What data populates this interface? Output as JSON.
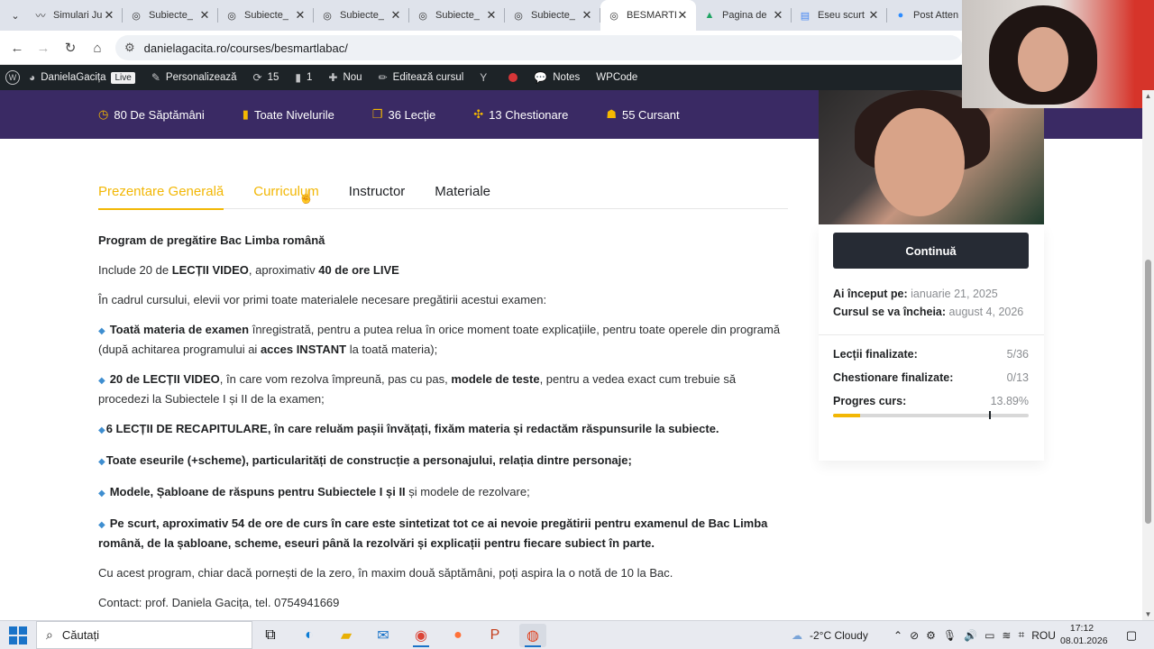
{
  "browser": {
    "tabs": [
      {
        "title": "Simulari Ju",
        "icon": "wave-icon"
      },
      {
        "title": "Subiecte_",
        "icon": "globe-icon"
      },
      {
        "title": "Subiecte_",
        "icon": "globe-icon"
      },
      {
        "title": "Subiecte_",
        "icon": "globe-icon"
      },
      {
        "title": "Subiecte_",
        "icon": "globe-icon"
      },
      {
        "title": "Subiecte_",
        "icon": "globe-icon"
      },
      {
        "title": "BESMARTL",
        "icon": "globe-icon",
        "active": true
      },
      {
        "title": "Pagina de",
        "icon": "drive-icon"
      },
      {
        "title": "Eseu scurt",
        "icon": "docs-icon"
      },
      {
        "title": "Post Atten",
        "icon": "zoom-icon"
      }
    ],
    "url": "danielagacita.ro/courses/besmartlabac/"
  },
  "wp_admin_bar": {
    "site_name": "DanielaGacița",
    "live_badge": "Live",
    "customize": "Personalizează",
    "updates_count": "15",
    "comments_count": "1",
    "new": "Nou",
    "edit_course": "Editează cursul",
    "notes": "Notes",
    "wpcode": "WPCode"
  },
  "course_meta": {
    "duration": "80 De Săptămâni",
    "level": "Toate Nivelurile",
    "lessons": "36 Lecție",
    "quizzes": "13 Chestionare",
    "students": "55 Cursant"
  },
  "tabs": {
    "overview": "Prezentare Generală",
    "curriculum": "Curriculum",
    "instructor": "Instructor",
    "materials": "Materiale"
  },
  "content": {
    "heading": "Program de pregătire Bac Limba română",
    "p1_a": "Include 20 de ",
    "p1_b": "LECȚII VIDEO",
    "p1_c": ", aproximativ ",
    "p1_d": "40 de ore LIVE",
    "p2": "În cadrul cursului, elevii vor primi toate materialele necesare pregătirii acestui examen:",
    "b1_a": "Toată materia de examen",
    "b1_b": " înregistrată, pentru a putea relua în orice moment toate explicațiile, pentru toate operele din programă (după achitarea programului ai ",
    "b1_c": "acces INSTANT",
    "b1_d": " la toată materia);",
    "b2_a": "20 de LECȚII VIDEO",
    "b2_b": ", în care vom rezolva împreună, pas cu pas, ",
    "b2_c": "modele de teste",
    "b2_d": ", pentru a vedea exact cum trebuie să procedezi la  Subiectele I și II de la examen;",
    "b3": "6 LECȚII DE RECAPITULARE, în care reluăm pașii învățați, fixăm materia și redactăm răspunsurile la subiecte.",
    "b4": "Toate eseurile (+scheme), particularități de construcție a personajului, relația dintre personaje;",
    "b5_a": "Modele, Șabloane de răspuns pentru Subiectele I și  II",
    "b5_b": " și modele de rezolvare;",
    "b6": "Pe scurt, aproximativ 54 de ore de curs în care este sintetizat tot ce ai nevoie pregătirii pentru examenul de Bac Limba română, de la șabloane, scheme, eseuri până la rezolvări  și explicații pentru fiecare subiect în parte.",
    "p3": "Cu acest program, chiar dacă pornești de la zero, în maxim două săptămâni, poți aspira la o notă de 10 la Bac.",
    "contact": "Contact: prof. Daniela Gacița, tel. 0754941669"
  },
  "sidebar": {
    "continue_button": "Continuă",
    "started_label": "Ai început pe:",
    "started_value": "ianuarie 21, 2025",
    "ends_label": "Cursul se va încheia:",
    "ends_value": "august 4, 2026",
    "lessons_label": "Lecții finalizate:",
    "lessons_value": "5/36",
    "quizzes_label": "Chestionare finalizate:",
    "quizzes_value": "0/13",
    "progress_label": "Progres curs:",
    "progress_value": "13.89%",
    "progress_fraction": 0.1389
  },
  "taskbar": {
    "search_placeholder": "Căutați",
    "weather": "-2°C  Cloudy",
    "language": "ROU",
    "time": "17:12",
    "date": "08.01.2026"
  },
  "colors": {
    "accent": "#f2b705",
    "banner": "#3a2a64",
    "button": "#262b34"
  }
}
